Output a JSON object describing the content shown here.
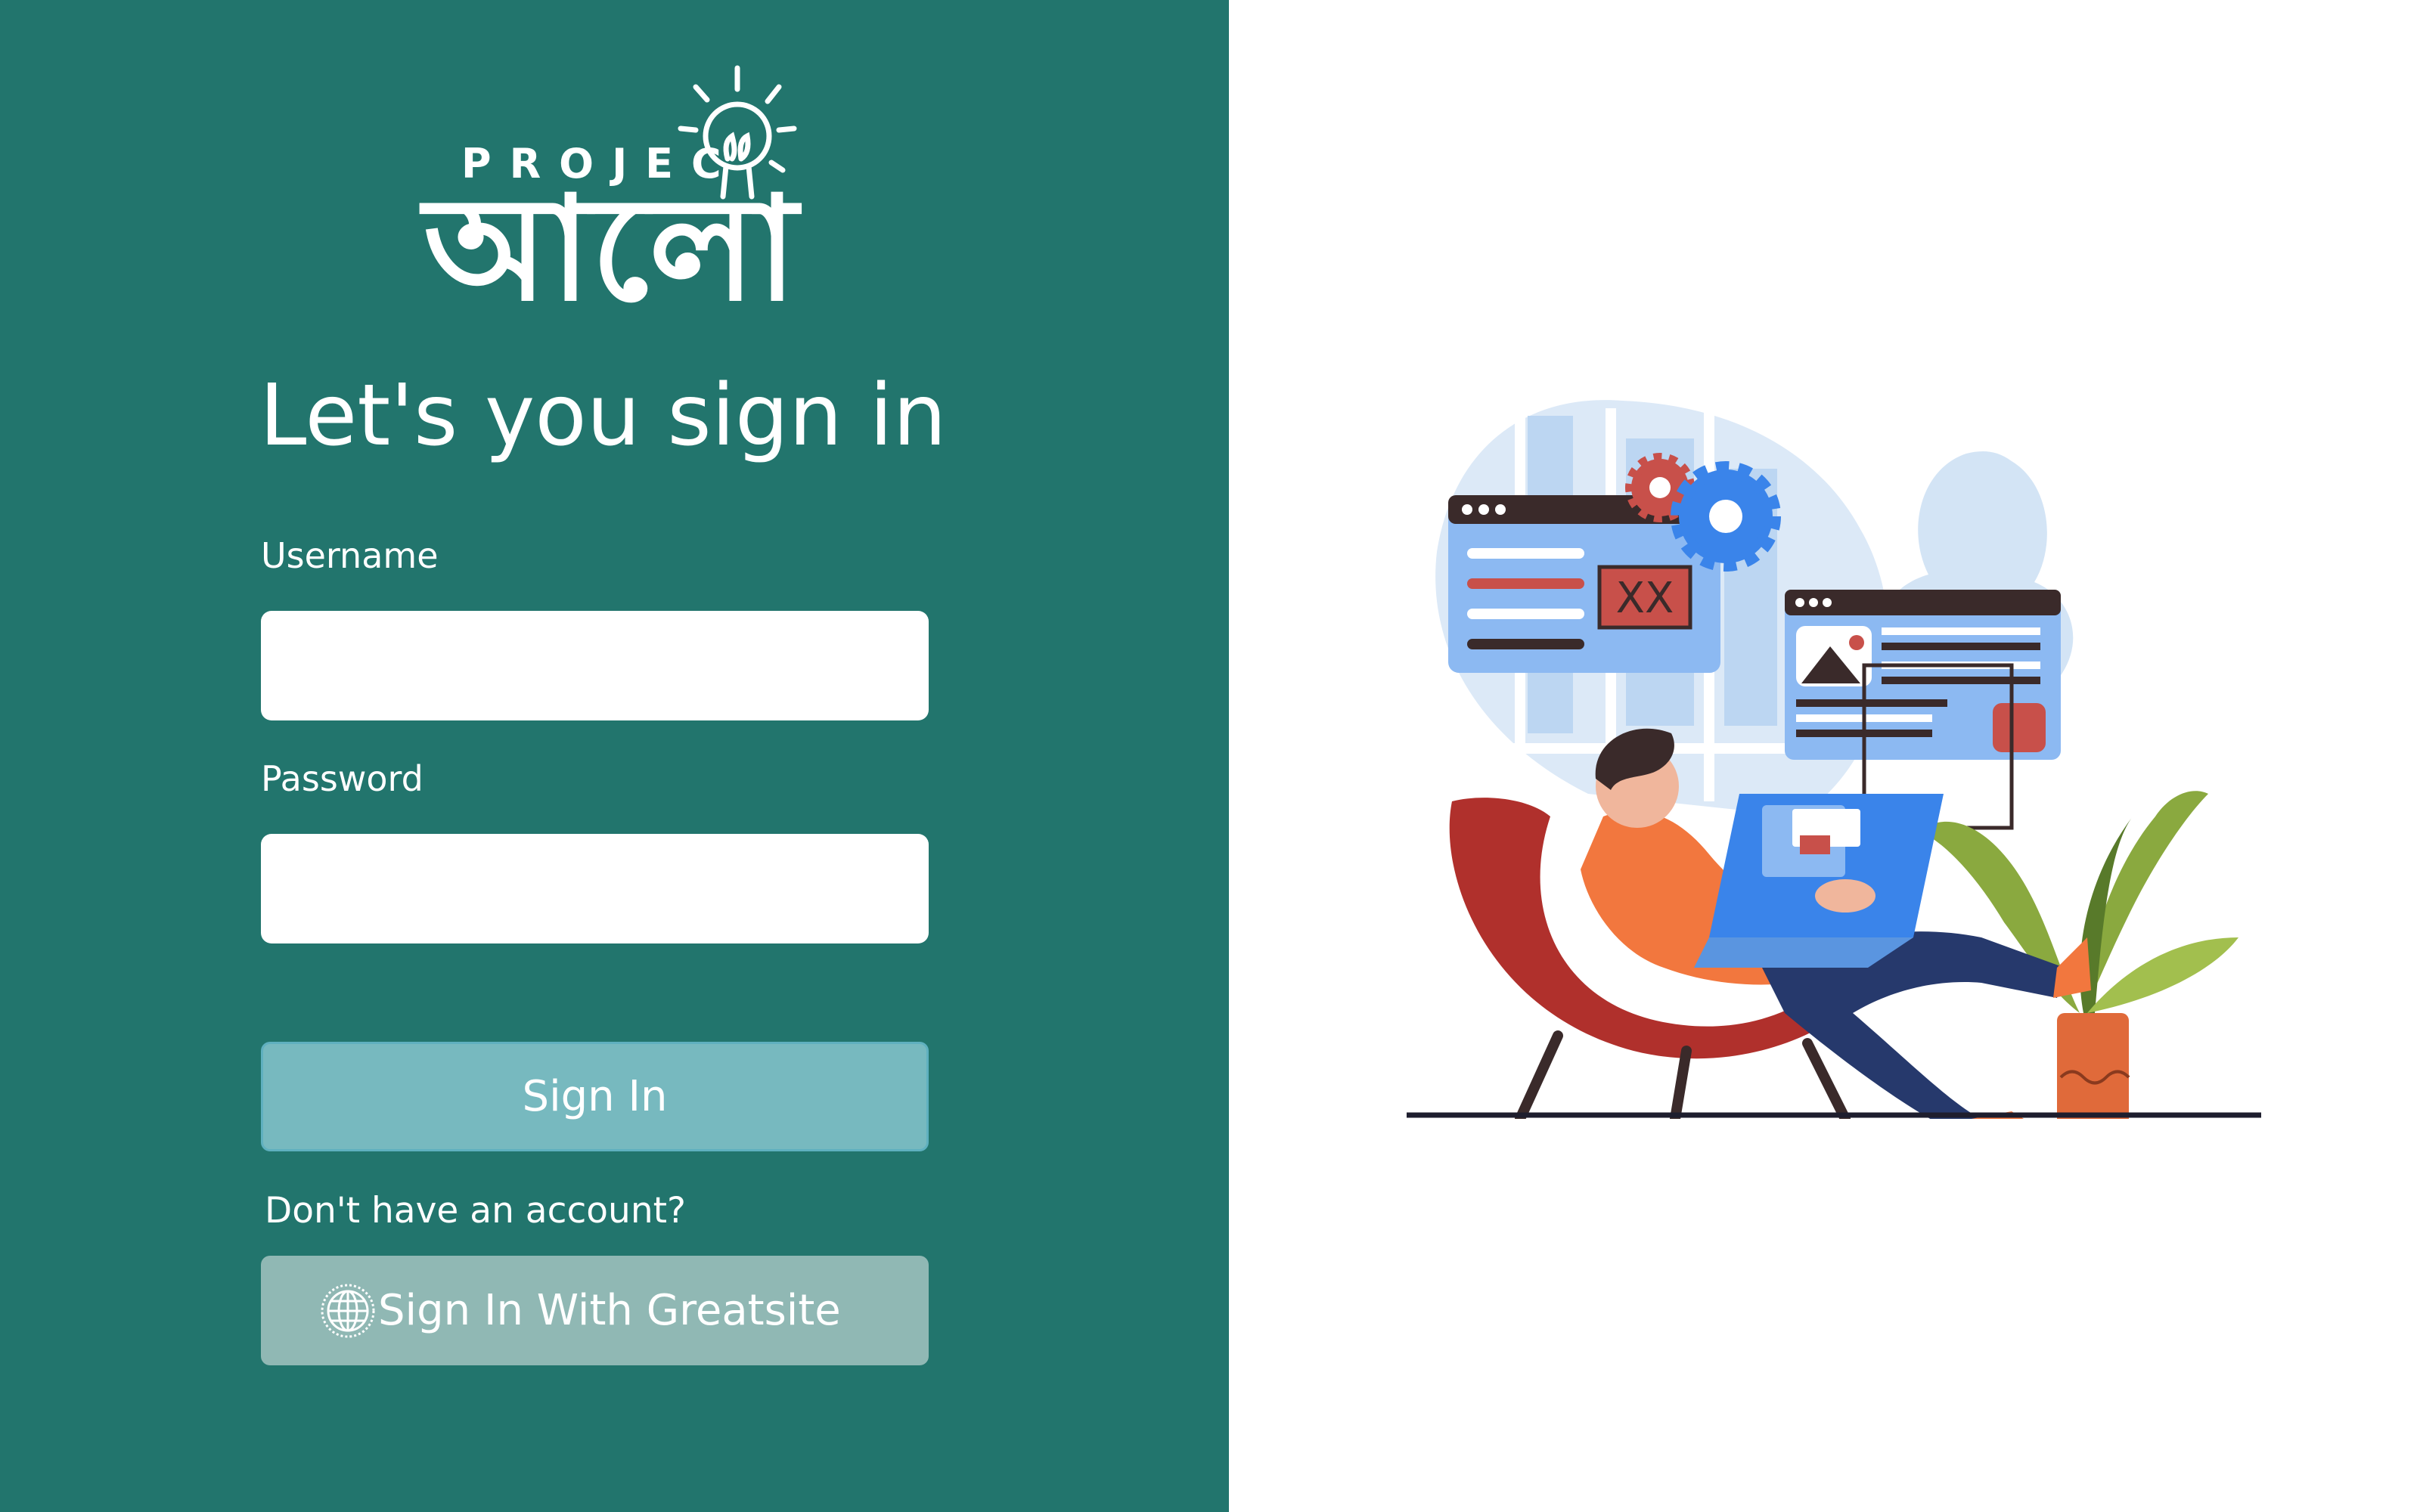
{
  "logo": {
    "top_text": "PROJEC",
    "main_text": "আলো"
  },
  "signin_form": {
    "heading": "Let's you sign in",
    "username_label": "Username",
    "username_value": "",
    "password_label": "Password",
    "password_value": "",
    "submit_label": "Sign In"
  },
  "alt_signin": {
    "prompt": "Don't have an account?",
    "button_label": "Sign In With Greatsite",
    "icon": "globe-icon"
  },
  "illustration": {
    "browser_mock_text": "XX"
  },
  "colors": {
    "panel": "#22756d",
    "signin_button": "#77b9bf",
    "greatsite_button": "#90b8b4"
  }
}
